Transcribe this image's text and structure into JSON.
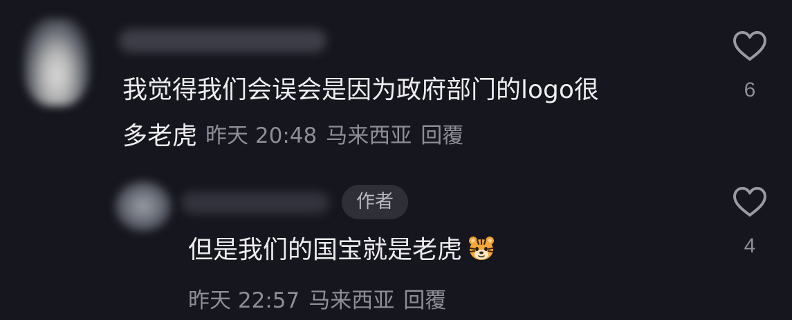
{
  "comments": [
    {
      "text_line1": "我觉得我们会误会是因为政府部门的logo很",
      "text_line2": "多老虎",
      "time": "昨天 20:48",
      "location": "马来西亚",
      "reply_label": "回覆",
      "likes": "6",
      "icons": {
        "like": "heart-outline-icon"
      }
    },
    {
      "badge": "作者",
      "text": "但是我们的国宝就是老虎",
      "emoji": "tiger-face-icon",
      "time": "昨天 22:57",
      "location": "马来西亚",
      "reply_label": "回覆",
      "likes": "4",
      "icons": {
        "like": "heart-outline-icon"
      }
    }
  ],
  "colors": {
    "background": "#16161e",
    "text_primary": "#ededf0",
    "text_secondary": "#8e8e97",
    "badge_bg": "#2f2f38"
  }
}
